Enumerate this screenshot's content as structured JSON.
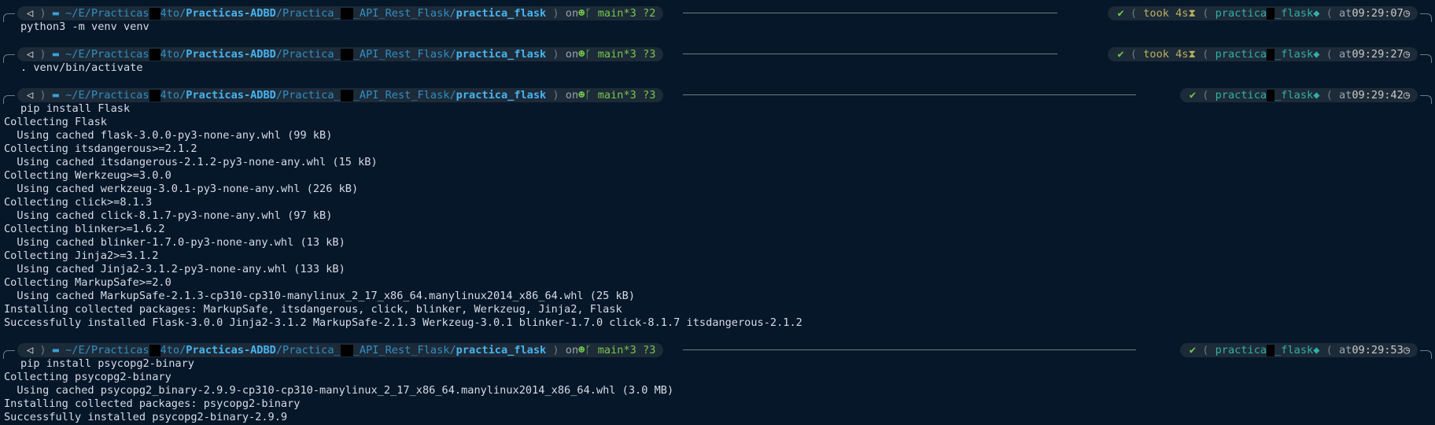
{
  "colors": {
    "background": "#06172a",
    "path": "#2f8fc4",
    "git": "#74c94a",
    "venv": "#2fb0a8",
    "took": "#b8b060"
  },
  "prompts": [
    {
      "os_icon": "◁",
      "path_pre": "~/E/Practicas",
      "path_mid": "4to/",
      "path_proj": "Practicas-ADBD",
      "path_rest": "/Practica_",
      "path_api": "_API_Rest_Flask/",
      "path_last": "practica_flask",
      "on": "on",
      "branch": "main",
      "status": "*3 ?2",
      "check": "✔",
      "took": "took 4s",
      "venv_pre": "practica",
      "venv_post": "_flask",
      "at": "at",
      "time": "09:29:07",
      "command": "python3 -m venv venv"
    },
    {
      "os_icon": "◁",
      "path_pre": "~/E/Practicas",
      "path_mid": "4to/",
      "path_proj": "Practicas-ADBD",
      "path_rest": "/Practica_",
      "path_api": "_API_Rest_Flask/",
      "path_last": "practica_flask",
      "on": "on",
      "branch": "main",
      "status": "*3 ?3",
      "check": "✔",
      "took": "took 4s",
      "venv_pre": "practica",
      "venv_post": "_flask",
      "at": "at",
      "time": "09:29:27",
      "command": ". venv/bin/activate"
    },
    {
      "os_icon": "◁",
      "path_pre": "~/E/Practicas",
      "path_mid": "4to/",
      "path_proj": "Practicas-ADBD",
      "path_rest": "/Practica_",
      "path_api": "_API_Rest_Flask/",
      "path_last": "practica_flask",
      "on": "on",
      "branch": "main",
      "status": "*3 ?3",
      "check": "✔",
      "took": "",
      "venv_pre": "practica",
      "venv_post": "_flask",
      "at": "at",
      "time": "09:29:42",
      "command": "pip install Flask"
    },
    {
      "os_icon": "◁",
      "path_pre": "~/E/Practicas",
      "path_mid": "4to/",
      "path_proj": "Practicas-ADBD",
      "path_rest": "/Practica_",
      "path_api": "_API_Rest_Flask/",
      "path_last": "practica_flask",
      "on": "on",
      "branch": "main",
      "status": "*3 ?3",
      "check": "✔",
      "took": "",
      "venv_pre": "practica",
      "venv_post": "_flask",
      "at": "at",
      "time": "09:29:53",
      "command": "pip install psycopg2-binary"
    }
  ],
  "output1": [
    "Collecting Flask",
    "  Using cached flask-3.0.0-py3-none-any.whl (99 kB)",
    "Collecting itsdangerous>=2.1.2",
    "  Using cached itsdangerous-2.1.2-py3-none-any.whl (15 kB)",
    "Collecting Werkzeug>=3.0.0",
    "  Using cached werkzeug-3.0.1-py3-none-any.whl (226 kB)",
    "Collecting click>=8.1.3",
    "  Using cached click-8.1.7-py3-none-any.whl (97 kB)",
    "Collecting blinker>=1.6.2",
    "  Using cached blinker-1.7.0-py3-none-any.whl (13 kB)",
    "Collecting Jinja2>=3.1.2",
    "  Using cached Jinja2-3.1.2-py3-none-any.whl (133 kB)",
    "Collecting MarkupSafe>=2.0",
    "  Using cached MarkupSafe-2.1.3-cp310-cp310-manylinux_2_17_x86_64.manylinux2014_x86_64.whl (25 kB)",
    "Installing collected packages: MarkupSafe, itsdangerous, click, blinker, Werkzeug, Jinja2, Flask",
    "Successfully installed Flask-3.0.0 Jinja2-3.1.2 MarkupSafe-2.1.3 Werkzeug-3.0.1 blinker-1.7.0 click-8.1.7 itsdangerous-2.1.2"
  ],
  "output2": [
    "Collecting psycopg2-binary",
    "  Using cached psycopg2_binary-2.9.9-cp310-cp310-manylinux_2_17_x86_64.manylinux2014_x86_64.whl (3.0 MB)",
    "Installing collected packages: psycopg2-binary",
    "Successfully installed psycopg2-binary-2.9.9"
  ]
}
